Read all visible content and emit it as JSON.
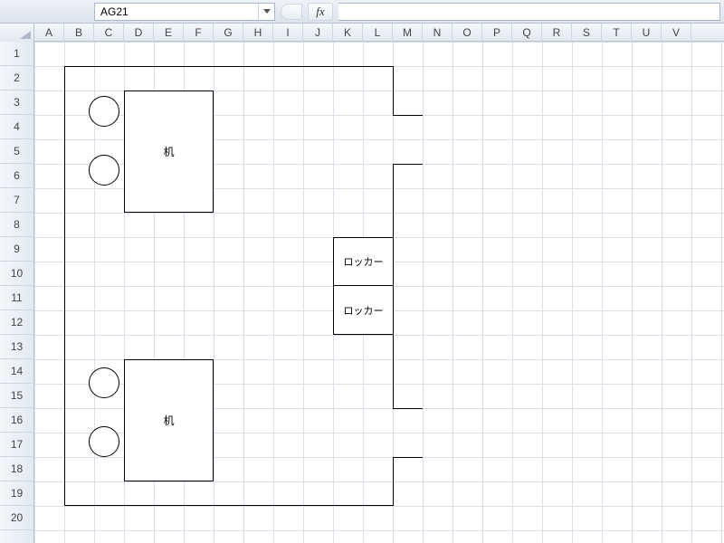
{
  "formula_bar": {
    "cell_ref": "AG21",
    "fx_label": "fx",
    "formula_value": ""
  },
  "grid": {
    "columns": [
      "A",
      "B",
      "C",
      "D",
      "E",
      "F",
      "G",
      "H",
      "I",
      "J",
      "K",
      "L",
      "M",
      "N",
      "O",
      "P",
      "Q",
      "R",
      "S",
      "T",
      "U",
      "V"
    ],
    "rows": [
      "1",
      "2",
      "3",
      "4",
      "5",
      "6",
      "7",
      "8",
      "9",
      "10",
      "11",
      "12",
      "13",
      "14",
      "15",
      "16",
      "17",
      "18",
      "19",
      "20"
    ]
  },
  "shapes": {
    "desk_label_1": "机",
    "desk_label_2": "机",
    "locker_label_1": "ロッカー",
    "locker_label_2": "ロッカー"
  }
}
